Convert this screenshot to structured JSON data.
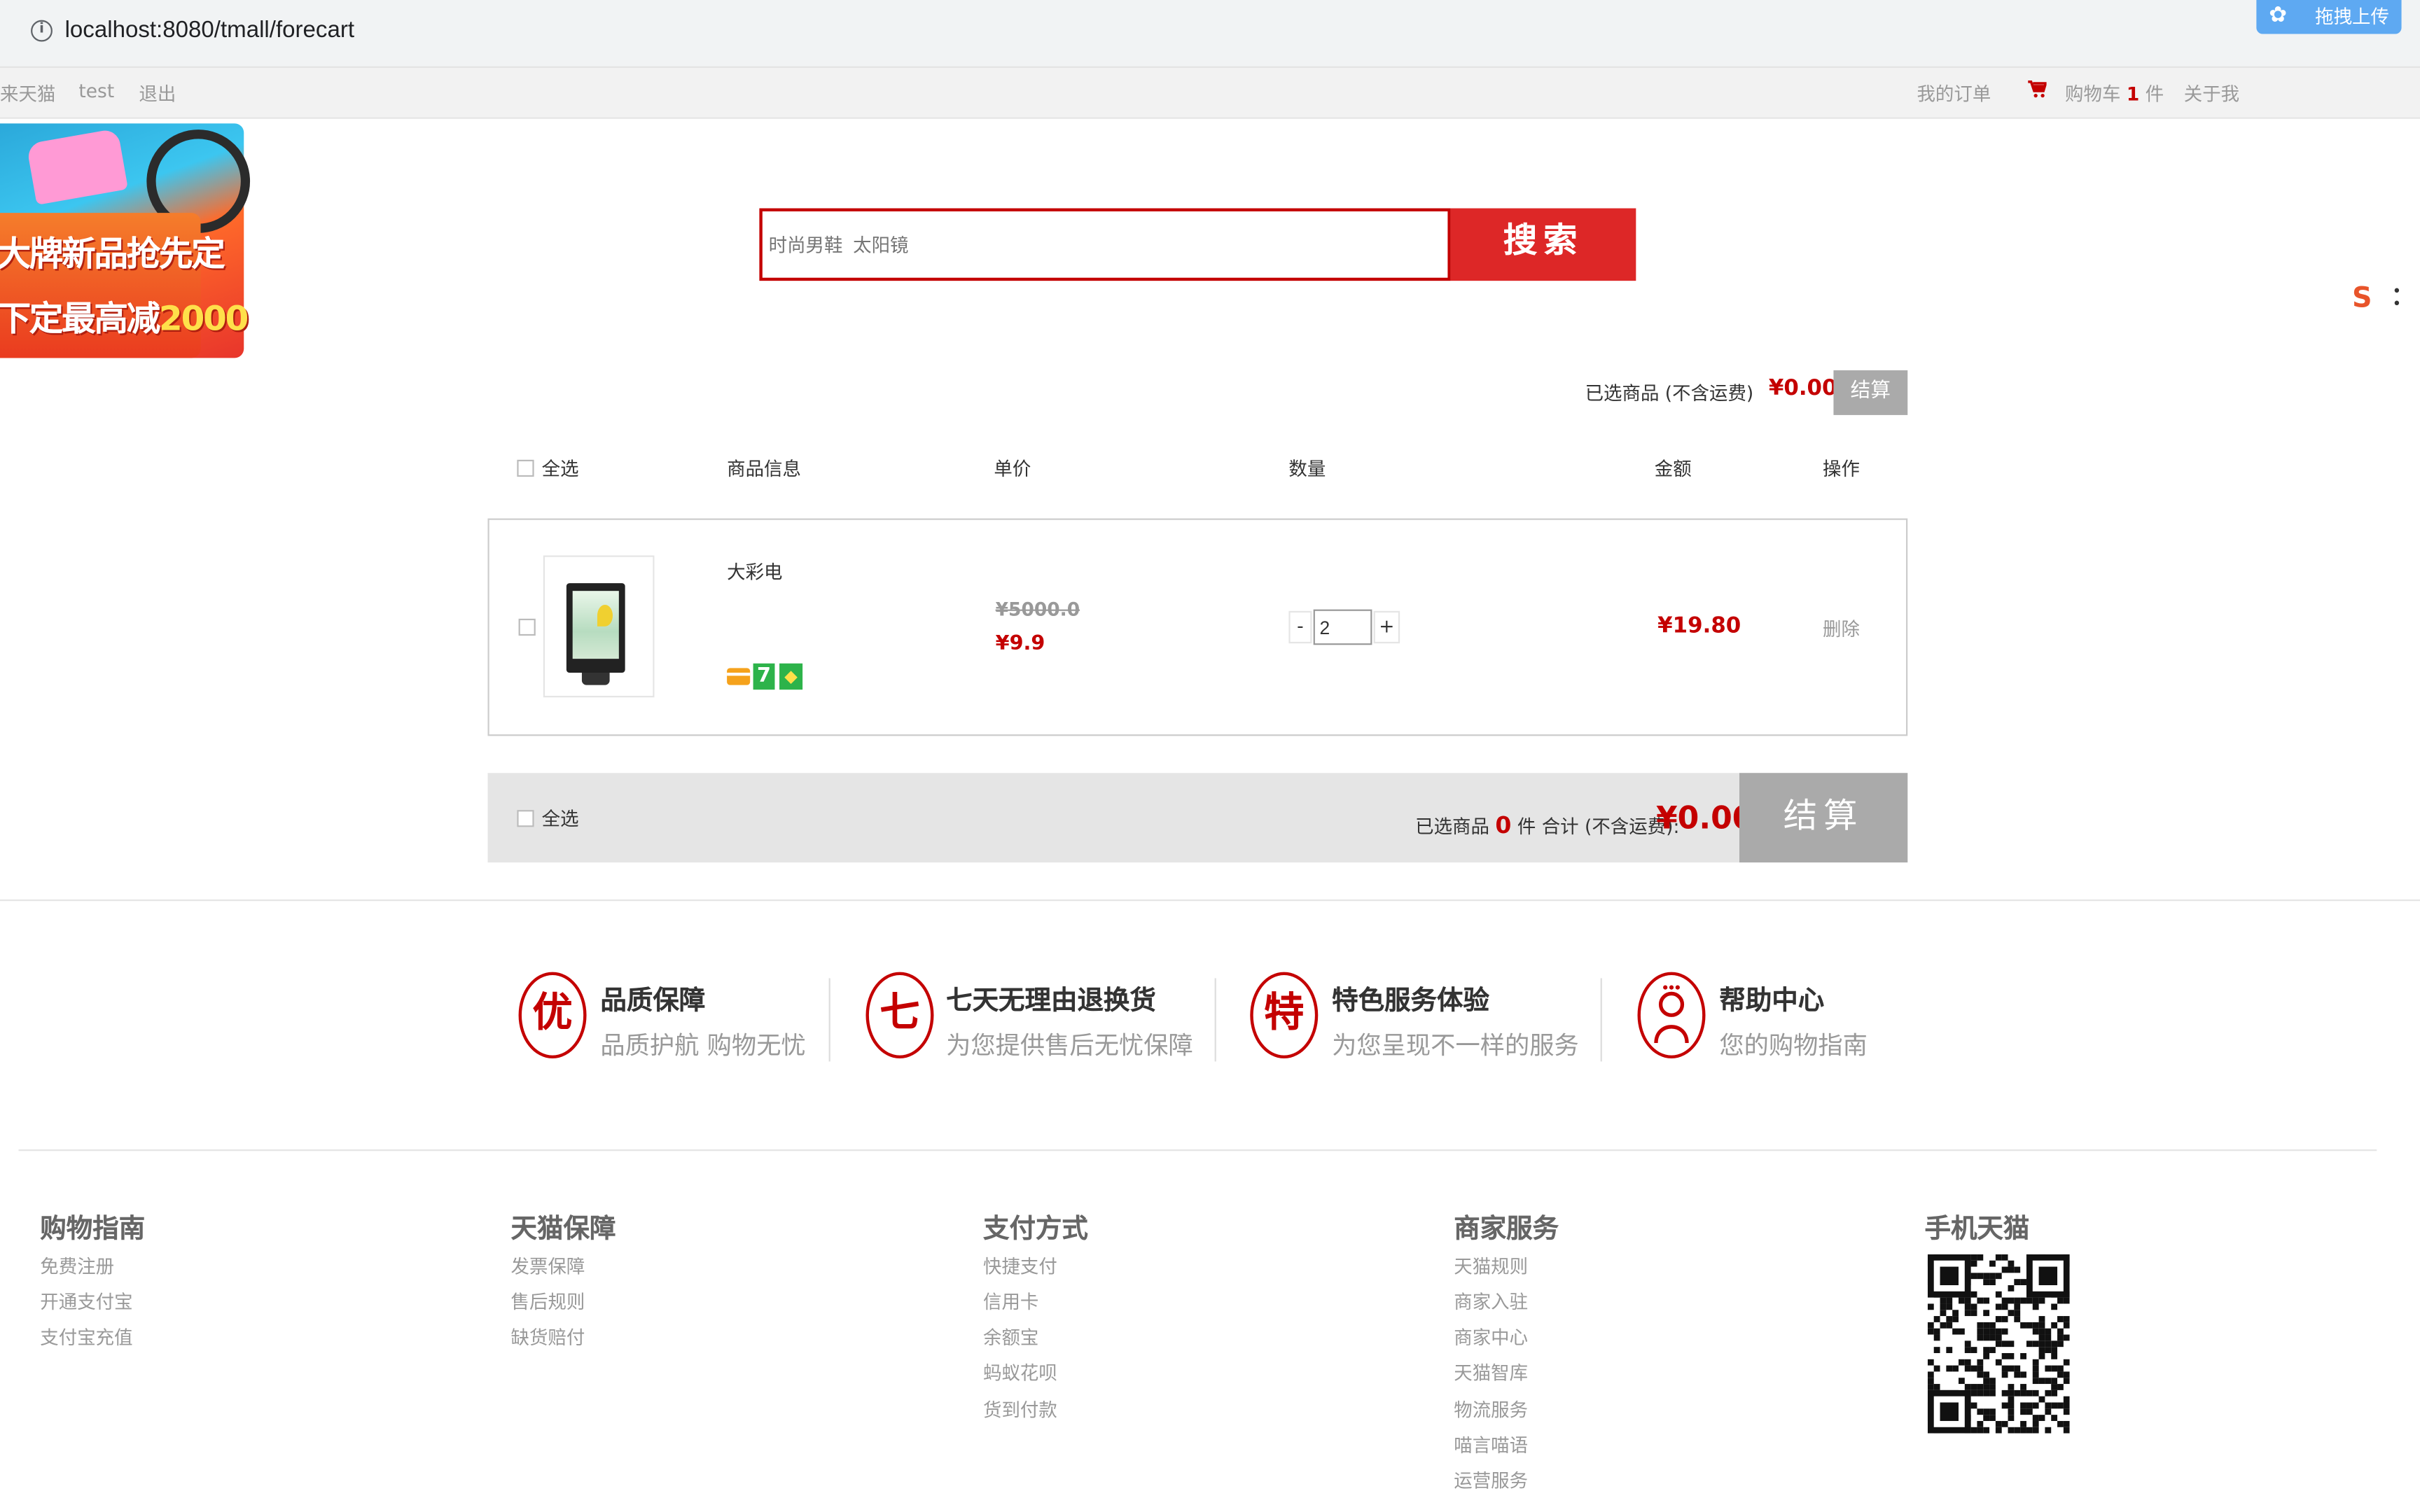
{
  "browser": {
    "url": "localhost:8080/tmall/forecart",
    "upload_label": "拖拽上传"
  },
  "topnav": {
    "left_links": [
      "来天猫",
      "test",
      "退出"
    ],
    "orders": "我的订单",
    "cart_prefix": "购物车",
    "cart_count": "1",
    "cart_suffix": "件",
    "about": "关于我"
  },
  "banner": {
    "line1": "大牌新品抢先定",
    "line2_text": "下定最高减",
    "line2_num": "2000"
  },
  "search": {
    "placeholder": "时尚男鞋  太阳镜",
    "button": "搜索"
  },
  "summary_top": {
    "label": "已选商品 (不含运费)",
    "price": "¥0.00",
    "button": "结算"
  },
  "table": {
    "headers": [
      "全选",
      "商品信息",
      "单价",
      "数量",
      "金额",
      "操作"
    ]
  },
  "item": {
    "name": "大彩电",
    "badge_number": "7",
    "old_price": "¥5000.0",
    "price": "¥9.9",
    "quantity": "2",
    "minus": "-",
    "plus": "+",
    "subtotal": "¥19.80",
    "delete": "删除"
  },
  "bottom_bar": {
    "select_all": "全选",
    "selected_prefix": "已选商品",
    "selected_count": "0",
    "selected_suffix": "件 合计 (不含运费):",
    "total": "¥0.00",
    "button": "结算"
  },
  "services": [
    {
      "icon_char": "优",
      "title": "品质保障",
      "subtitle": "品质护航 购物无忧"
    },
    {
      "icon_char": "七",
      "title": "七天无理由退换货",
      "subtitle": "为您提供售后无忧保障"
    },
    {
      "icon_char": "特",
      "title": "特色服务体验",
      "subtitle": "为您呈现不一样的服务"
    },
    {
      "icon_char": "",
      "title": "帮助中心",
      "subtitle": "您的购物指南"
    }
  ],
  "footer": {
    "columns": [
      {
        "title": "购物指南",
        "links": [
          "免费注册",
          "开通支付宝",
          "支付宝充值"
        ]
      },
      {
        "title": "天猫保障",
        "links": [
          "发票保障",
          "售后规则",
          "缺货赔付"
        ]
      },
      {
        "title": "支付方式",
        "links": [
          "快捷支付",
          "信用卡",
          "余额宝",
          "蚂蚁花呗",
          "货到付款"
        ]
      },
      {
        "title": "商家服务",
        "links": [
          "天猫规则",
          "商家入驻",
          "商家中心",
          "天猫智库",
          "物流服务",
          "喵言喵语",
          "运营服务"
        ]
      },
      {
        "title": "手机天猫",
        "links": []
      }
    ]
  },
  "colors": {
    "accent_red": "#c40000",
    "search_red": "#dd2727",
    "button_gray": "#aaaaaa"
  }
}
